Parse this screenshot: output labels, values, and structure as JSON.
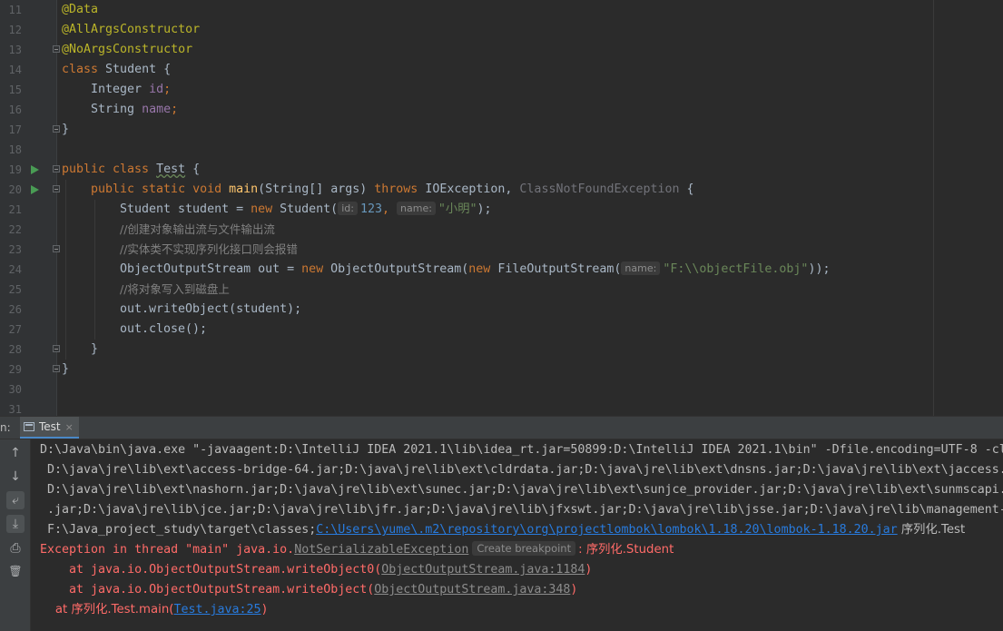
{
  "editor": {
    "lines": [
      {
        "n": "11",
        "text": "@Data"
      },
      {
        "n": "12",
        "text": "@AllArgsConstructor"
      },
      {
        "n": "13",
        "text": "@NoArgsConstructor"
      },
      {
        "n": "14",
        "kw": "class",
        "name": "Student",
        "rest": " {"
      },
      {
        "n": "15",
        "type": "Integer",
        "field": "id"
      },
      {
        "n": "16",
        "type": "String",
        "field": "name"
      },
      {
        "n": "17",
        "text": "}"
      },
      {
        "n": "18",
        "text": ""
      },
      {
        "n": "19",
        "kw": "public class",
        "name": "Test",
        "rest": " {"
      },
      {
        "n": "20",
        "kw1": "public static void",
        "fn": "main",
        "params": "(String[] args)",
        "kw2": "throws",
        "ex1": "IOException,",
        "ex2": "ClassNotFoundException",
        "rest": " {"
      },
      {
        "n": "21",
        "pre": "Student student = ",
        "kw": "new",
        "ctor": " Student(",
        "hint1": "id:",
        "num": "123",
        "sep": ",",
        "hint2": "name:",
        "str": "\"小明\"",
        "end": ");"
      },
      {
        "n": "22",
        "comment": "//创建对象输出流与文件输出流"
      },
      {
        "n": "23",
        "comment": "//实体类不实现序列化接口则会报错"
      },
      {
        "n": "24",
        "pre": "ObjectOutputStream out = ",
        "kw1": "new",
        "mid": " ObjectOutputStream(",
        "kw2": "new",
        "ctor": " FileOutputStream(",
        "hint": "name:",
        "str": "\"F:\\\\objectFile.obj\"",
        "end": "));"
      },
      {
        "n": "25",
        "comment": "//将对象写入到磁盘上"
      },
      {
        "n": "26",
        "text": "out.writeObject(student);"
      },
      {
        "n": "27",
        "text": "out.close();"
      },
      {
        "n": "28",
        "text": "}"
      },
      {
        "n": "29",
        "text": "}"
      },
      {
        "n": "30",
        "text": ""
      },
      {
        "n": "31",
        "text": ""
      }
    ]
  },
  "run_panel": {
    "prefix": "n:",
    "tab_label": "Test",
    "tab_close": "×"
  },
  "console": {
    "lines": [
      "D:\\Java\\bin\\java.exe \"-javaagent:D:\\IntelliJ IDEA 2021.1\\lib\\idea_rt.jar=50899:D:\\IntelliJ IDEA 2021.1\\bin\" -Dfile.encoding=UTF-8 -cl",
      " D:\\java\\jre\\lib\\ext\\access-bridge-64.jar;D:\\java\\jre\\lib\\ext\\cldrdata.jar;D:\\java\\jre\\lib\\ext\\dnsns.jar;D:\\java\\jre\\lib\\ext\\jaccess.",
      " D:\\java\\jre\\lib\\ext\\nashorn.jar;D:\\java\\jre\\lib\\ext\\sunec.jar;D:\\java\\jre\\lib\\ext\\sunjce_provider.jar;D:\\java\\jre\\lib\\ext\\sunmscapi.",
      " .jar;D:\\java\\jre\\lib\\jce.jar;D:\\java\\jre\\lib\\jfr.jar;D:\\java\\jre\\lib\\jfxswt.jar;D:\\java\\jre\\lib\\jsse.jar;D:\\java\\jre\\lib\\management-"
    ],
    "classpath_prefix": " F:\\Java_project_study\\target\\classes;",
    "classpath_link": "C:\\Users\\yume\\.m2\\repository\\org\\projectlombok\\lombok\\1.18.20\\lombok-1.18.20.jar",
    "classpath_suffix": " 序列化.Test",
    "exception_prefix": "Exception in thread \"main\" java.io.",
    "exception_class": "NotSerializableException",
    "breakpoint_hint": "Create breakpoint",
    "exception_suffix": ": 序列化.Student",
    "stack": [
      {
        "pre": "    at java.io.ObjectOutputStream.writeObject0(",
        "link": "ObjectOutputStream.java:1184",
        "post": ")",
        "link_style": "grey"
      },
      {
        "pre": "    at java.io.ObjectOutputStream.writeObject(",
        "link": "ObjectOutputStream.java:348",
        "post": ")",
        "link_style": "grey"
      },
      {
        "pre": "    at 序列化.Test.main(",
        "link": "Test.java:25",
        "post": ")",
        "link_style": "blue"
      }
    ]
  },
  "toolbar": {
    "up": "↑",
    "down": "↓",
    "wrap": "⤶",
    "scroll_end": "⤓",
    "print": "⎙",
    "clear": "🗑"
  }
}
